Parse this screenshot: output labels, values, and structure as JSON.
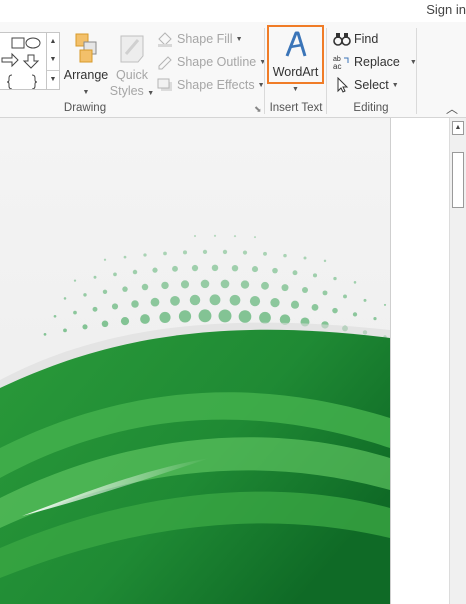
{
  "account": {
    "sign_in": "Sign in"
  },
  "ribbon": {
    "drawing": {
      "label": "Drawing",
      "arrange": "Arrange",
      "quick_styles_line1": "Quick",
      "quick_styles_line2": "Styles",
      "shape_fill": "Shape Fill",
      "shape_outline": "Shape Outline",
      "shape_effects": "Shape Effects"
    },
    "insert_text": {
      "label": "Insert Text",
      "wordart": "WordArt"
    },
    "editing": {
      "label": "Editing",
      "find": "Find",
      "replace": "Replace",
      "select": "Select"
    }
  },
  "colors": {
    "highlight": "#f07c27",
    "wordart_blue": "#3b75b8",
    "green_dark": "#1a7a2e",
    "green_light": "#4cb650",
    "dots": "#7cc08e"
  },
  "icons": [
    "shapes-gallery-icon",
    "arrange-icon",
    "quick-styles-icon",
    "paint-bucket-icon",
    "pencil-icon",
    "shape-effects-icon",
    "wordart-icon",
    "binoculars-icon",
    "replace-icon",
    "cursor-icon",
    "collapse-ribbon-icon",
    "dialog-launcher-icon"
  ]
}
